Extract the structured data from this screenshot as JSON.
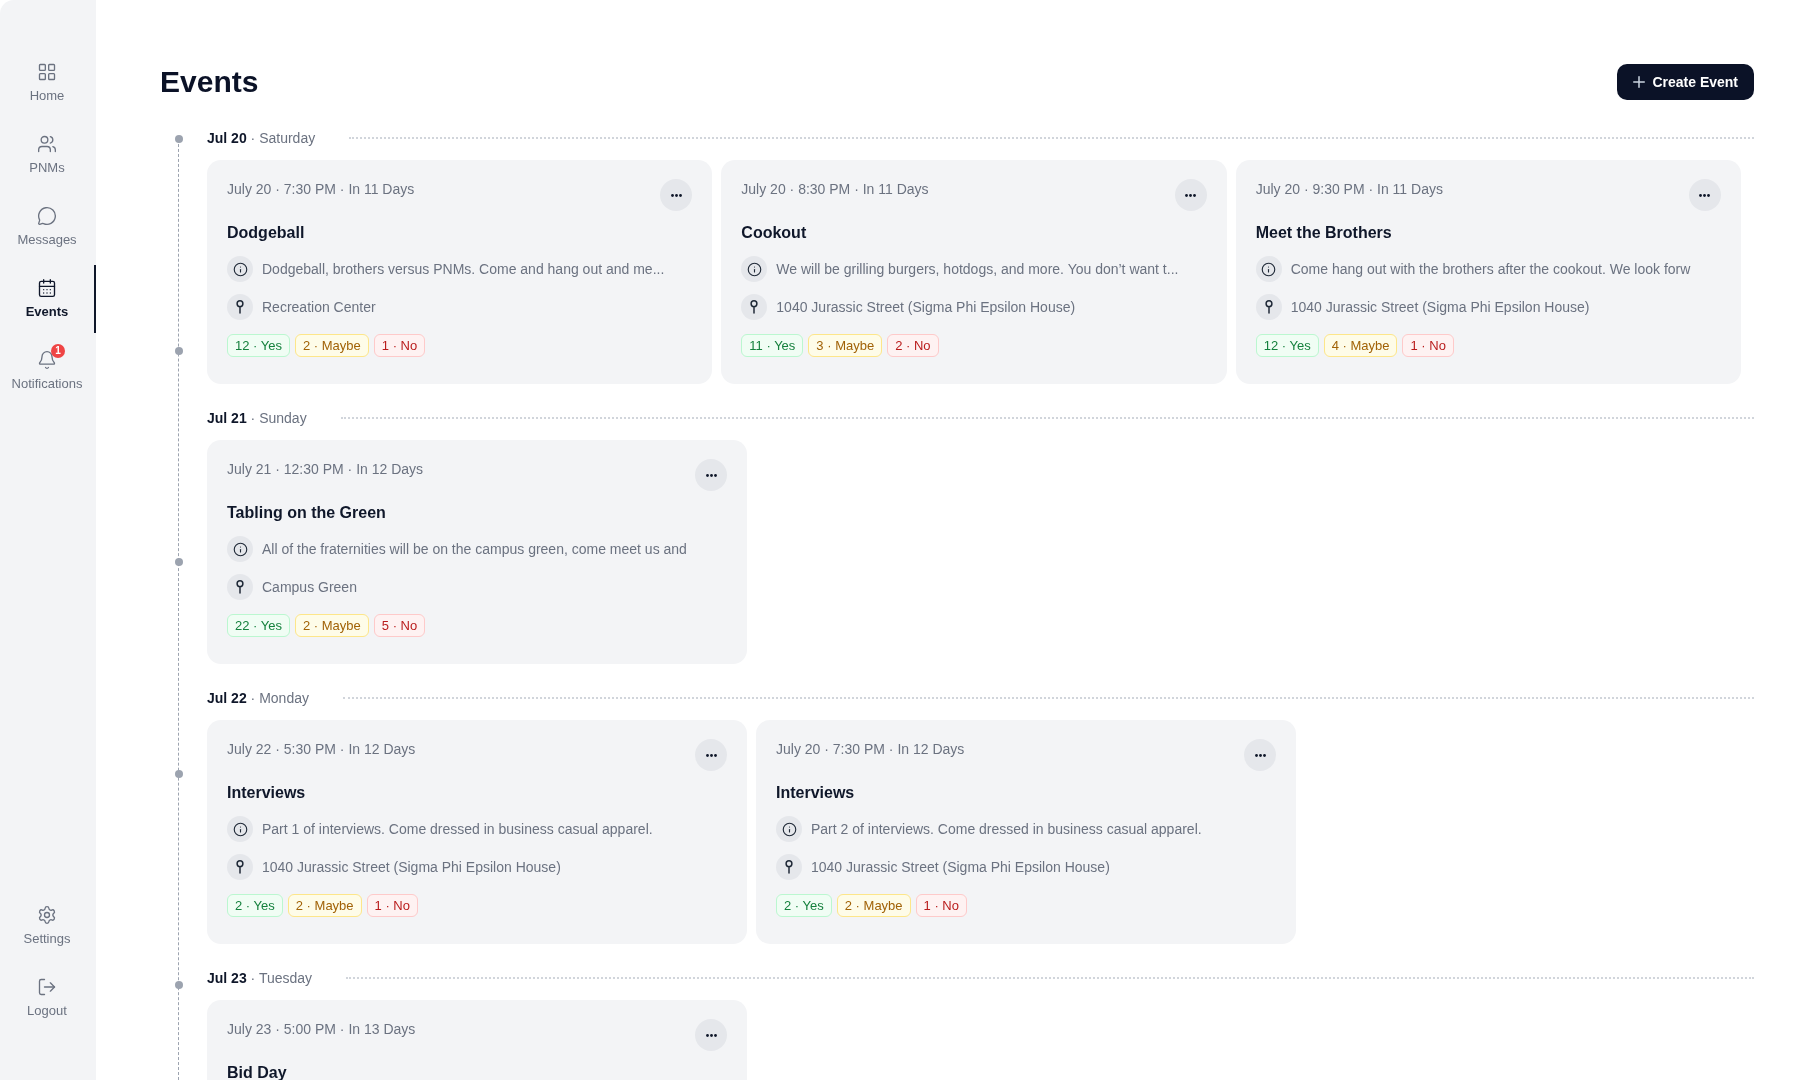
{
  "sidebar": {
    "top_items": [
      {
        "label": "Home",
        "selected": false
      },
      {
        "label": "PNMs",
        "selected": false
      },
      {
        "label": "Messages",
        "selected": false
      },
      {
        "label": "Events",
        "selected": true
      },
      {
        "label": "Notifications",
        "selected": false,
        "badge": "1"
      }
    ],
    "bottom_items": [
      {
        "label": "Settings",
        "selected": false
      },
      {
        "label": "Logout",
        "selected": false
      }
    ]
  },
  "header": {
    "title": "Events",
    "create_button": "Create Event"
  },
  "days": [
    {
      "heading": "**Jul 20** · Saturday",
      "events": [
        {
          "when": "July 20 · 7:30 PM · In 11 Days",
          "title": "Dodgeball",
          "description": "Dodgeball, brothers versus PNMs. Come and hang out and me...",
          "location": "Recreation Center",
          "rsvps": [
            {
              "kind": "yes",
              "label": "12 · Yes"
            },
            {
              "kind": "maybe",
              "label": "2 · Maybe"
            },
            {
              "kind": "no",
              "label": "1 · No"
            }
          ]
        },
        {
          "when": "July 20 · 8:30 PM · In 11 Days",
          "title": "Cookout",
          "description": "We will be grilling burgers, hotdogs, and more. You don’t want t...",
          "location": "1040 Jurassic Street (Sigma Phi Epsilon House)",
          "rsvps": [
            {
              "kind": "yes",
              "label": "11 · Yes"
            },
            {
              "kind": "maybe",
              "label": "3 · Maybe"
            },
            {
              "kind": "no",
              "label": "2 · No"
            }
          ]
        },
        {
          "when": "July 20 · 9:30 PM · In 11 Days",
          "title": "Meet the Brothers",
          "description": "Come hang out with the brothers after the cookout. We look forw",
          "location": "1040 Jurassic Street (Sigma Phi Epsilon House)",
          "rsvps": [
            {
              "kind": "yes",
              "label": "12 · Yes"
            },
            {
              "kind": "maybe",
              "label": "4 · Maybe"
            },
            {
              "kind": "no",
              "label": "1 · No"
            }
          ]
        }
      ]
    },
    {
      "heading": "**Jul 21** · Sunday",
      "events": [
        {
          "when": "July 21 · 12:30 PM · In 12 Days",
          "title": "Tabling on the Green",
          "description": "All of the fraternities will be on the campus green, come meet us and",
          "location": "Campus Green",
          "rsvps": [
            {
              "kind": "yes",
              "label": "22 · Yes"
            },
            {
              "kind": "maybe",
              "label": "2 · Maybe"
            },
            {
              "kind": "no",
              "label": "5 · No"
            }
          ]
        }
      ]
    },
    {
      "heading": "**Jul 22** · Monday",
      "events": [
        {
          "when": "July 22 · 5:30 PM · In 12 Days",
          "title": "Interviews",
          "description": "Part 1 of interviews. Come dressed in business casual apparel.",
          "location": "1040 Jurassic Street (Sigma Phi Epsilon House)",
          "rsvps": [
            {
              "kind": "yes",
              "label": "2 · Yes"
            },
            {
              "kind": "maybe",
              "label": "2 · Maybe"
            },
            {
              "kind": "no",
              "label": "1 · No"
            }
          ]
        },
        {
          "when": "July 20 · 7:30 PM · In 12 Days",
          "title": "Interviews",
          "description": "Part 2 of interviews. Come dressed in business casual apparel.",
          "location": "1040 Jurassic Street (Sigma Phi Epsilon House)",
          "rsvps": [
            {
              "kind": "yes",
              "label": "2 · Yes"
            },
            {
              "kind": "maybe",
              "label": "2 · Maybe"
            },
            {
              "kind": "no",
              "label": "1 · No"
            }
          ]
        }
      ]
    },
    {
      "heading": "**Jul 23** · Tuesday",
      "events": [
        {
          "when": "July 23 · 5:00 PM · In 13 Days",
          "title": "Bid Day"
        }
      ]
    }
  ]
}
